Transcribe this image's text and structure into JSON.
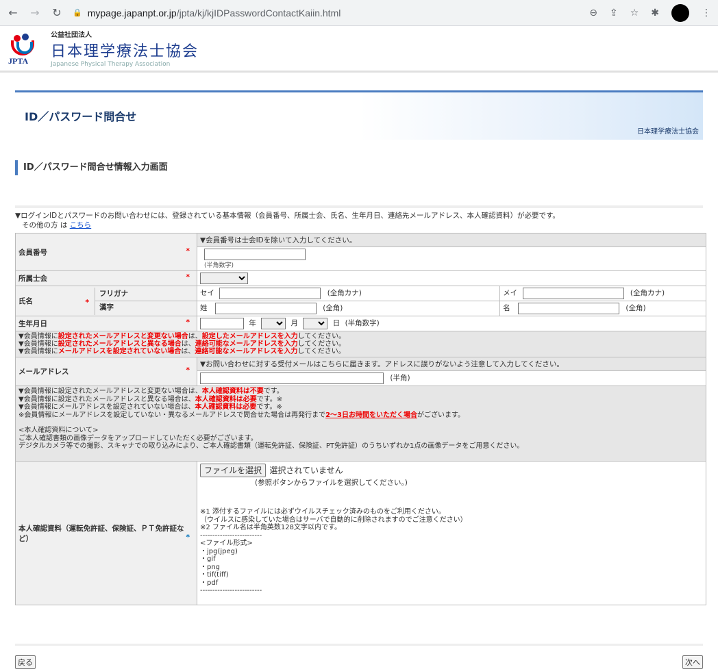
{
  "browser": {
    "back_icon": "arrow-left-icon",
    "url_domain": "mypage.japanpt.or.jp",
    "url_path": "/jpta/kj/kjIDPasswordContactKaiin.html"
  },
  "site": {
    "logo_abbr": "JPTA",
    "org_small": "公益社団法人",
    "org_name": "日本理学療法士協会",
    "org_eng": "Japanese Physical Therapy Association"
  },
  "page": {
    "title": "ID／パスワード問合せ",
    "org_right": "日本理学療法士協会",
    "subtitle": "ID／パスワード問合せ情報入力画面",
    "intro_line1": "▼ログインIDとパスワードのお問い合わせには、登録されている基本情報（会員番号、所属士会、氏名、生年月日、連絡先メールアドレス、本人確認資料）が必要です。",
    "intro_line2_prefix": "その他の方 は ",
    "intro_link": "こちら"
  },
  "form": {
    "member_note": "▼会員番号は士会IDを除いて入力してください。",
    "member_label": "会員番号",
    "member_hint": "(半角数字)",
    "branch_label": "所属士会",
    "name_label": "氏名",
    "furigana_label": "フリガナ",
    "kanji_label": "漢字",
    "sei_kana": "セイ",
    "mei_kana": "メイ",
    "kana_hint": "(全角カナ)",
    "sei_kanji": "姓",
    "mei_kanji": "名",
    "kanji_hint": "(全角)",
    "birth_label": "生年月日",
    "year": "年",
    "month": "月",
    "day": "日",
    "birth_hint": "(半角数字)",
    "mail_notes": [
      [
        "▼会員情報に",
        "設定されたメールアドレスと変更ない場合",
        "は、",
        "設定したメールアドレスを入力",
        "してください。"
      ],
      [
        "▼会員情報に",
        "設定されたメールアドレスと異なる場合",
        "は、",
        "連絡可能なメールアドレスを入力",
        "してください。"
      ],
      [
        "▼会員情報に",
        "メールアドレスを設定されていない場合",
        "は、",
        "連絡可能なメールアドレスを入力",
        "してください。"
      ]
    ],
    "mail_note2": "▼お問い合わせに対する受付メールはこちらに届きます。アドレスに誤りがないよう注意して入力してください。",
    "mail_label": "メールアドレス",
    "mail_hint": "(半角)",
    "id_notes": {
      "l1a": "▼会員情報に設定されたメールアドレスと変更ない場合は、",
      "l1b": "本人確認資料は不要",
      "l1c": "です。",
      "l2a": "▼会員情報に設定されたメールアドレスと異なる場合は、",
      "l2b": "本人確認資料は必要",
      "l2c": "です。※",
      "l3a": "▼会員情報にメールアドレスを設定されていない場合は、",
      "l3b": "本人確認資料は必要",
      "l3c": "です。※",
      "l4a": "※会員情報にメールアドレスを設定していない・異なるメールアドレスで問合せた場合は再発行まで",
      "l4b": "2〜3日お時間をいただく場合",
      "l4c": "がございます。",
      "l5": "<本人確認資料について>",
      "l6": "ご本人確認書類の画像データをアップロードしていただく必要がございます。",
      "l7": "デジタルカメラ等での撮影、スキャナでの取り込みにより、ご本人確認書類（運転免許証、保険証、PT免許証）のうちいずれか1点の画像データをご用意ください。"
    },
    "id_label": "本人確認資料（運転免許証、保険証、ＰＴ免許証など）",
    "file_button": "ファイルを選択",
    "file_status": "選択されていません",
    "file_hint": "(参照ボタンからファイルを選択してください。)",
    "file_rules": [
      "※1 添付するファイルには必ずウイルスチェック済みのものをご利用ください。",
      "（ウイルスに感染していた場合はサーバで自動的に削除されますのでご注意ください）",
      "※2 ファイル名は半角英数128文字以内です。",
      "-------------------------",
      "<ファイル形式>",
      "・jpg(jpeg)",
      "・gif",
      "・png",
      "・tif(tiff)",
      "・pdf",
      "-------------------------"
    ]
  },
  "footer": {
    "back": "戻る",
    "next": "次へ"
  }
}
